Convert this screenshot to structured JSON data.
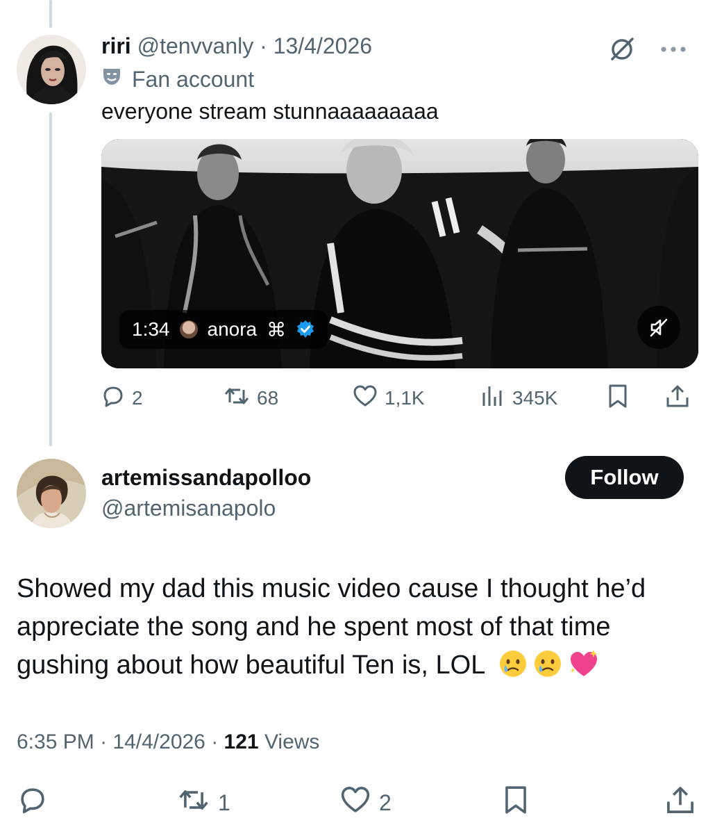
{
  "quoted_tweet": {
    "name": "riri",
    "handle": "@tenvvanly",
    "separator": " · ",
    "date": "13/4/2026",
    "label": "Fan account",
    "text": "everyone stream stunnaaaaaaaaa",
    "media": {
      "duration": "1:34",
      "creator": "anora",
      "creator_symbol": "⌘"
    },
    "actions": {
      "replies": "2",
      "reposts": "68",
      "likes": "1,1K",
      "views": "345K"
    }
  },
  "main_tweet": {
    "name": "artemissandapolloo",
    "handle": "@artemisanapolo",
    "follow_label": "Follow",
    "text": "Showed my dad this music video cause I thought he’d appreciate the song and he spent most of that time gushing about how beautiful Ten is, LOL",
    "time": "6:35 PM",
    "date": "14/4/2026",
    "sep": " · ",
    "views_count": "121",
    "views_label": " Views",
    "actions": {
      "reposts": "1",
      "likes": "2"
    }
  },
  "colors": {
    "text": "#0f1419",
    "muted": "#536471",
    "verified": "#1d9bf0",
    "thread_line": "#cfd9de"
  }
}
